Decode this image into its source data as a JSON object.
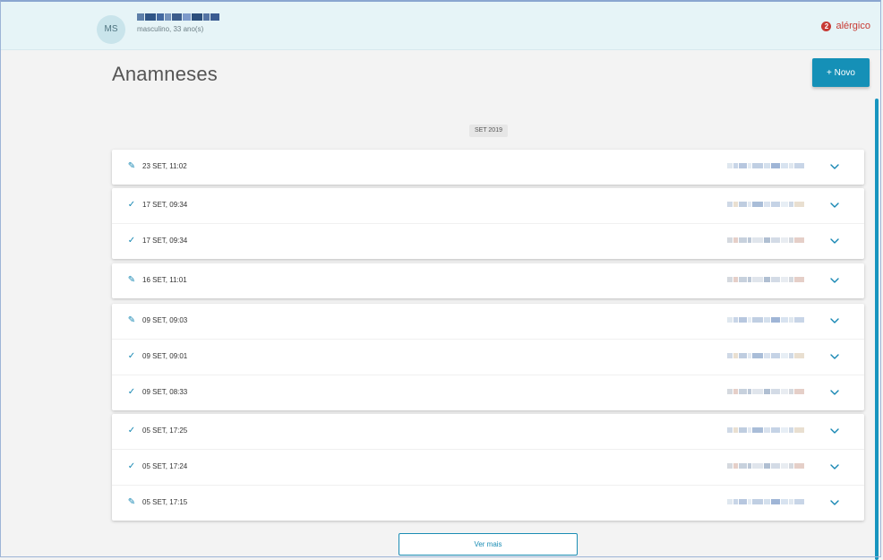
{
  "patient": {
    "initials": "MS",
    "meta": "masculino, 33 ano(s)",
    "allergy_count": "2",
    "allergy_label": "alérgico"
  },
  "page": {
    "title": "Anamneses",
    "new_button_label": "+ Novo",
    "month_label": "SET 2019",
    "more_button_label": "Ver mais"
  },
  "groups": [
    {
      "entries": [
        {
          "icon": "pencil-icon",
          "time": "23 SET, 11:02"
        }
      ]
    },
    {
      "entries": [
        {
          "icon": "check-icon",
          "time": "17 SET, 09:34"
        },
        {
          "icon": "check-icon",
          "time": "17 SET, 09:34"
        }
      ]
    },
    {
      "entries": [
        {
          "icon": "pencil-icon",
          "time": "16 SET, 11:01"
        }
      ]
    },
    {
      "entries": [
        {
          "icon": "pencil-icon",
          "time": "09 SET, 09:03"
        },
        {
          "icon": "check-icon",
          "time": "09 SET, 09:01"
        },
        {
          "icon": "check-icon",
          "time": "09 SET, 08:33"
        }
      ]
    },
    {
      "entries": [
        {
          "icon": "check-icon",
          "time": "05 SET, 17:25"
        },
        {
          "icon": "check-icon",
          "time": "05 SET, 17:24"
        },
        {
          "icon": "pencil-icon",
          "time": "05 SET, 17:15"
        }
      ]
    }
  ],
  "colors": {
    "accent": "#1590b7",
    "header_bg": "#e6f4f7",
    "alert": "#c73a35"
  }
}
